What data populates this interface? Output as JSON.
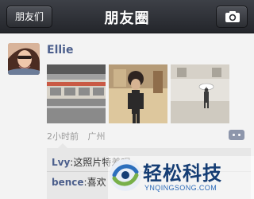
{
  "header": {
    "title": "朋友圈",
    "back_label": "朋友们",
    "camera_icon": "camera-icon"
  },
  "post": {
    "author": "Ellie",
    "meta": {
      "time": "2小时前",
      "location": "广州"
    },
    "photos": [
      "photo-1",
      "photo-2",
      "photo-3"
    ],
    "comment_icon": "comment-icon"
  },
  "comments": [
    {
      "author": "Lvy",
      "separator": ":",
      "text": "这照片特差呢"
    },
    {
      "author": "bence",
      "separator": ":",
      "text": "喜欢"
    }
  ],
  "watermark": {
    "text": "轻松科技",
    "url": "YNQINGSONG.COM"
  },
  "colors": {
    "navbar": "#2f3136",
    "link": "#4c5f8c",
    "comment_bg": "#e7e7e7",
    "background": "#f3f3f3"
  }
}
